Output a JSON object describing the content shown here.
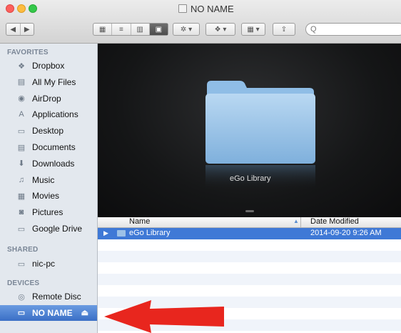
{
  "window": {
    "title": "NO NAME"
  },
  "toolbar": {
    "nav_back": "◀",
    "nav_forward": "▶",
    "view_icons": "▦",
    "view_list": "≡",
    "view_columns": "▥",
    "view_coverflow": "▣",
    "action": "✲ ▾",
    "dropbox": "❖ ▾",
    "arrange": "▦ ▾",
    "share": "⇪",
    "search_placeholder": "Q"
  },
  "sidebar": {
    "favorites_header": "FAVORITES",
    "favorites": [
      {
        "label": "Dropbox",
        "icon": "dropbox-icon",
        "glyph": "❖"
      },
      {
        "label": "All My Files",
        "icon": "all-files-icon",
        "glyph": "▤"
      },
      {
        "label": "AirDrop",
        "icon": "airdrop-icon",
        "glyph": "◉"
      },
      {
        "label": "Applications",
        "icon": "applications-icon",
        "glyph": "A"
      },
      {
        "label": "Desktop",
        "icon": "desktop-icon",
        "glyph": "▭"
      },
      {
        "label": "Documents",
        "icon": "documents-icon",
        "glyph": "▤"
      },
      {
        "label": "Downloads",
        "icon": "downloads-icon",
        "glyph": "⬇"
      },
      {
        "label": "Music",
        "icon": "music-icon",
        "glyph": "♫"
      },
      {
        "label": "Movies",
        "icon": "movies-icon",
        "glyph": "▦"
      },
      {
        "label": "Pictures",
        "icon": "pictures-icon",
        "glyph": "◙"
      },
      {
        "label": "Google Drive",
        "icon": "folder-icon",
        "glyph": "▭"
      }
    ],
    "shared_header": "SHARED",
    "shared": [
      {
        "label": "nic-pc",
        "icon": "computer-icon",
        "glyph": "▭"
      }
    ],
    "devices_header": "DEVICES",
    "devices": [
      {
        "label": "Remote Disc",
        "icon": "disc-icon",
        "glyph": "◎"
      },
      {
        "label": "NO NAME",
        "icon": "drive-icon",
        "glyph": "▭",
        "selected": true
      }
    ]
  },
  "coverflow": {
    "label": "eGo Library"
  },
  "list": {
    "columns": [
      "Name",
      "Date Modified"
    ],
    "rows": [
      {
        "name": "eGo Library",
        "date": "2014-09-20 9:26 AM"
      }
    ]
  },
  "colors": {
    "selection": "#3f79d6",
    "arrow": "#e8261e",
    "sidebar_bg": "#e3e8ee"
  }
}
